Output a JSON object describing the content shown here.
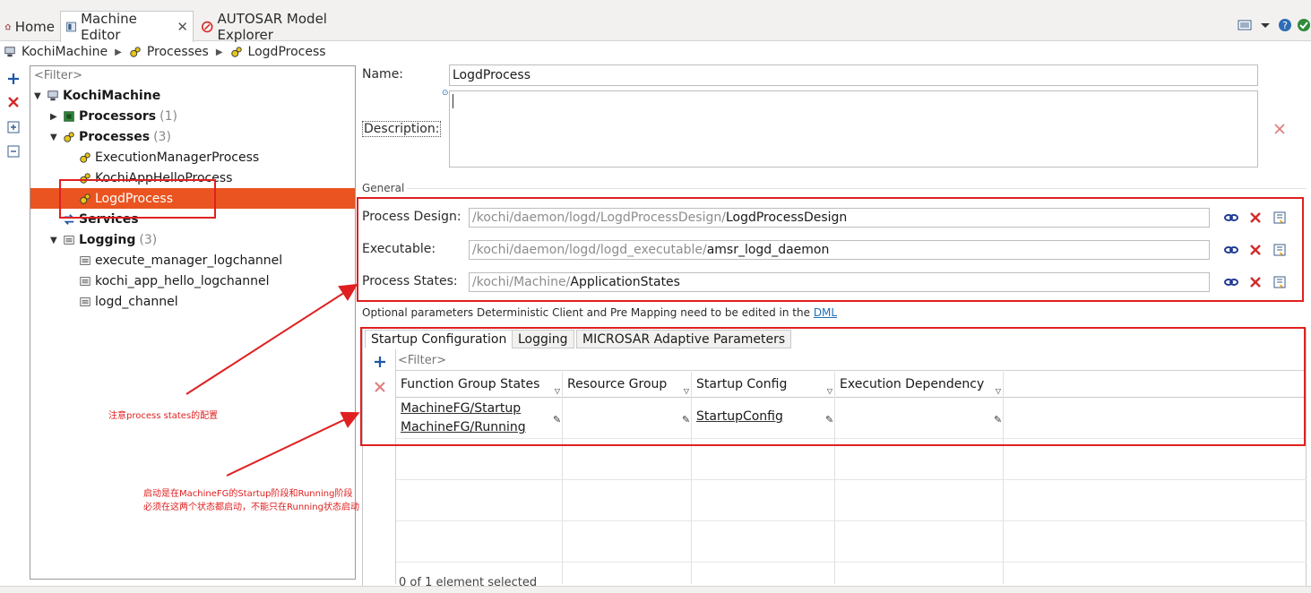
{
  "tabs": [
    {
      "label": "Home"
    },
    {
      "label": "Machine Editor",
      "close": "✕"
    },
    {
      "label": "AUTOSAR Model Explorer"
    }
  ],
  "breadcrumb": [
    "KochiMachine",
    "Processes",
    "LogdProcess"
  ],
  "tree": {
    "filter_placeholder": "<Filter>",
    "root": "KochiMachine",
    "processors": {
      "label": "Processors",
      "count": "(1)"
    },
    "processes": {
      "label": "Processes",
      "count": "(3)"
    },
    "process_items": [
      "ExecutionManagerProcess",
      "KochiAppHelloProcess",
      "LogdProcess"
    ],
    "services": {
      "label": "Services"
    },
    "logging": {
      "label": "Logging",
      "count": "(3)"
    },
    "logging_items": [
      "execute_manager_logchannel",
      "kochi_app_hello_logchannel",
      "logd_channel"
    ]
  },
  "form": {
    "name_label": "Name:",
    "name_value": "LogdProcess",
    "description_label": "Description:",
    "general_label": "General",
    "process_design_label": "Process Design:",
    "process_design_path": "/kochi/daemon/logd/LogdProcessDesign/",
    "process_design_value": "LogdProcessDesign",
    "executable_label": "Executable:",
    "executable_path": "/kochi/daemon/logd/logd_executable/",
    "executable_value": "amsr_logd_daemon",
    "process_states_label": "Process States:",
    "process_states_path": "/kochi/Machine/",
    "process_states_value": "ApplicationStates",
    "optional_text": "Optional parameters Deterministic Client and Pre Mapping need to be edited in the ",
    "optional_link": "DML"
  },
  "inner_tabs": [
    "Startup Configuration",
    "Logging",
    "MICROSAR Adaptive Parameters"
  ],
  "table": {
    "filter_placeholder": "<Filter>",
    "columns": [
      "Function Group States",
      "Resource Group",
      "Startup Config",
      "Execution Dependency"
    ],
    "row": {
      "fg_states": [
        "MachineFG/Startup",
        "MachineFG/Running"
      ],
      "resource_group": "",
      "startup_config": "StartupConfig",
      "execution_dependency": ""
    },
    "status": "0 of 1 element selected"
  },
  "notes": {
    "note1": "注意process states的配置",
    "note2_line1": "启动是在MachineFG的Startup阶段和Running阶段",
    "note2_line2": "必须在这两个状态都启动，不能只在Running状态启动"
  },
  "colors": {
    "selection": "#e95420",
    "annotation": "#e02020",
    "link": "#1f6fb5"
  }
}
